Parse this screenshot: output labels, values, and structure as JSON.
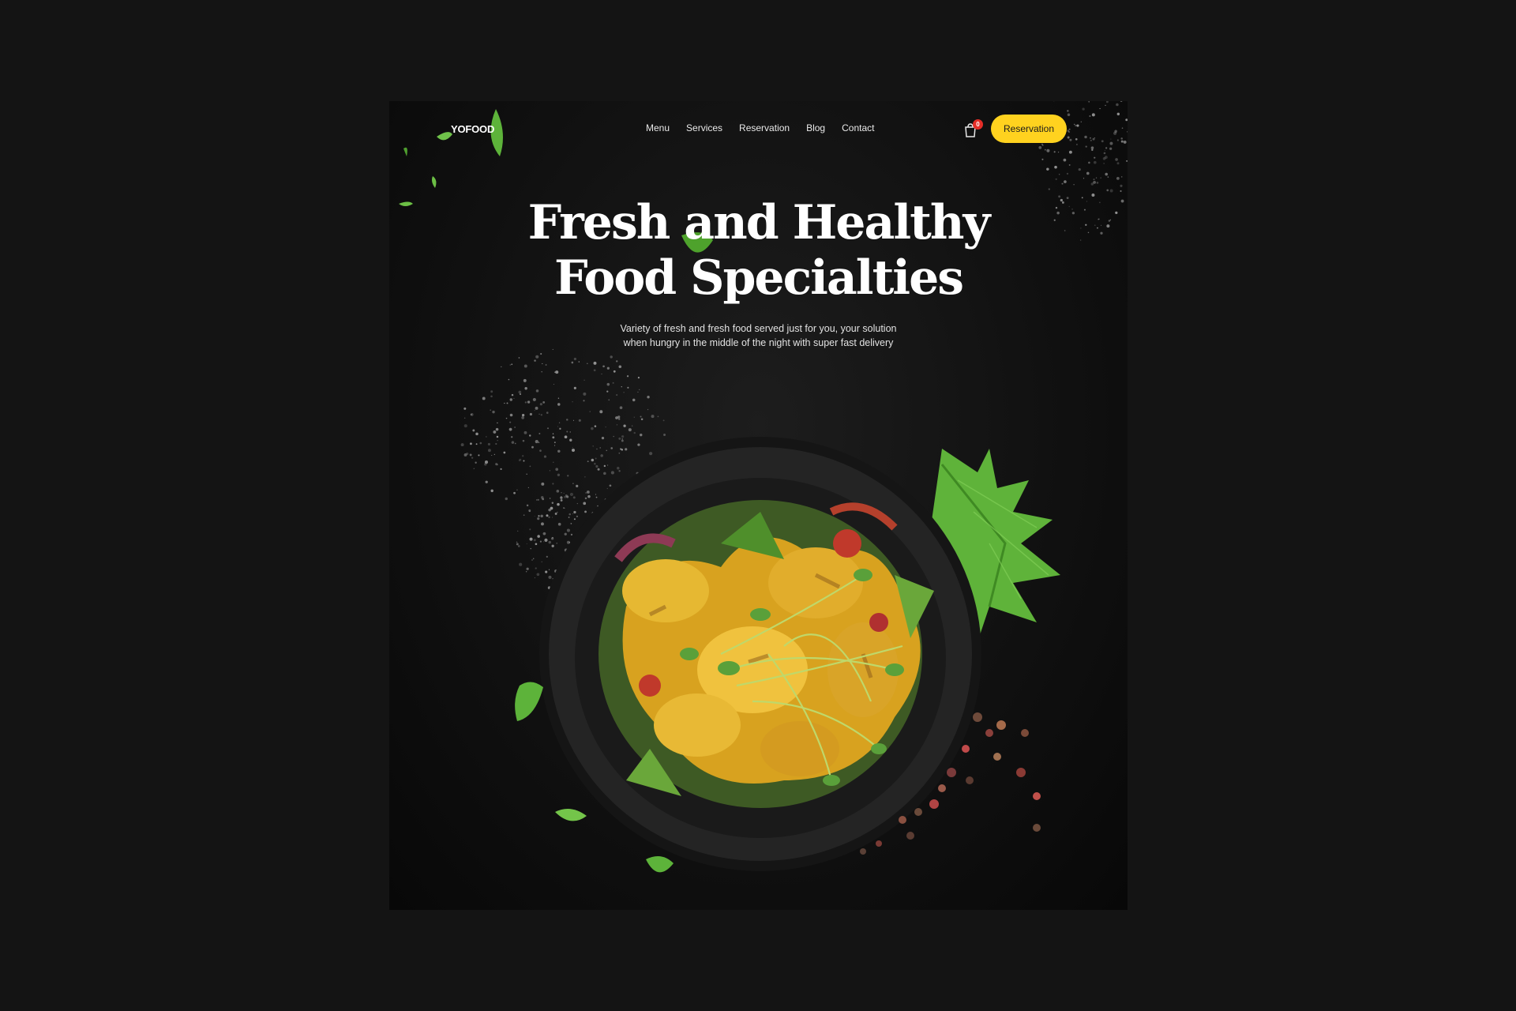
{
  "header": {
    "logo_text": "YOFOOD",
    "nav": [
      "Menu",
      "Services",
      "Reservation",
      "Blog",
      "Contact"
    ],
    "cart_count": "0",
    "cta_label": "Reservation"
  },
  "hero": {
    "title_line1": "Fresh and Healthy",
    "title_line2": "Food Specialties",
    "subtitle": "Variety of fresh and fresh food served just for you, your solution when hungry in the middle of the night with super fast delivery"
  },
  "colors": {
    "background": "#141414",
    "accent": "#ffd21f",
    "badge": "#e52d27"
  },
  "icons": [
    "leaf-icon",
    "cart-icon"
  ]
}
